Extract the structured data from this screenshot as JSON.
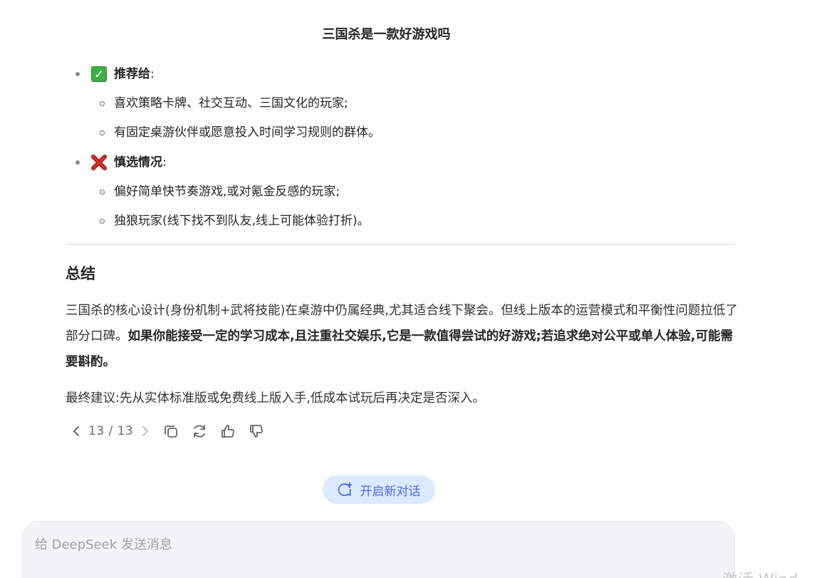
{
  "chat": {
    "title": "三国杀是一款好游戏吗"
  },
  "answer": {
    "recommend": {
      "label": "推荐给",
      "colon": ":",
      "items": [
        "喜欢策略卡牌、社交互动、三国文化的玩家;",
        "有固定桌游伙伴或愿意投入时间学习规则的群体。"
      ]
    },
    "caution": {
      "label": "慎选情况",
      "colon": ":",
      "items": [
        "偏好简单快节奏游戏,或对氪金反感的玩家;",
        "独狼玩家(线下找不到队友,线上可能体验打折)。"
      ]
    },
    "summary_title": "总结",
    "summary_plain": "三国杀的核心设计(身份机制+武将技能)在桌游中仍属经典,尤其适合线下聚会。但线上版本的运营模式和平衡性问题拉低了部分口碑。",
    "summary_bold": "如果你能接受一定的学习成本,且注重社交娱乐,它是一款值得尝试的好游戏;若追求绝对公平或单人体验,可能需要斟酌。",
    "advice": "最终建议:先从实体标准版或免费线上版入手,低成本试玩后再决定是否深入。"
  },
  "pager": {
    "text": "13 / 13"
  },
  "new_chat": {
    "label": "开启新对话"
  },
  "composer": {
    "placeholder": "给 DeepSeek 发送消息",
    "value": ""
  },
  "watermark": {
    "text": "激活 Wind"
  },
  "colors": {
    "accent": "#4d6bfe",
    "new_chat_bg": "#dbeafe",
    "check_green": "#3cb043",
    "cross_red": "#d62d20"
  }
}
